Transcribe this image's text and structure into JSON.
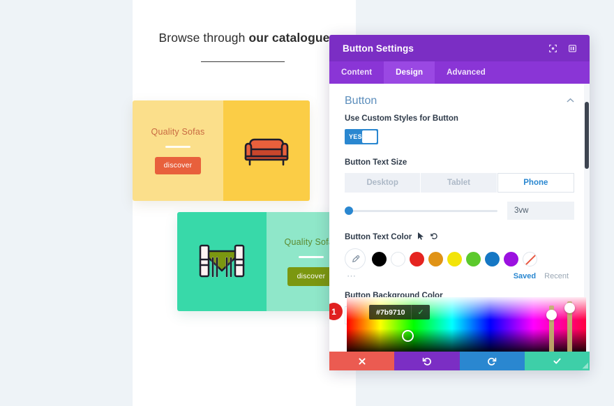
{
  "page": {
    "headline_plain": "Browse through ",
    "headline_bold": "our catalogue",
    "cards": [
      {
        "title": "Quality Sofas",
        "button_label": "discover",
        "icon": "sofa-icon",
        "panel_color": "#fbdf8b",
        "image_color": "#fbcd46",
        "button_color": "#e8603c"
      },
      {
        "title": "Quality Sofas",
        "button_label": "discover",
        "icon": "dining-table-icon",
        "panel_color": "#8fe7c9",
        "image_color": "#38d9a9",
        "button_color": "#7b9710"
      }
    ]
  },
  "modal": {
    "title": "Button Settings",
    "header_icons": [
      {
        "name": "focus-icon"
      },
      {
        "name": "layout-panel-icon"
      }
    ],
    "tabs": [
      {
        "label": "Content",
        "active": false
      },
      {
        "label": "Design",
        "active": true
      },
      {
        "label": "Advanced",
        "active": false
      }
    ],
    "section": {
      "title": "Button",
      "collapse_icon": "chevron-up-icon"
    },
    "custom_styles": {
      "label": "Use Custom Styles for Button",
      "toggle_value": "YES",
      "toggle_on": true
    },
    "text_size": {
      "label": "Button Text Size",
      "devices": [
        {
          "label": "Desktop",
          "active": false
        },
        {
          "label": "Tablet",
          "active": false
        },
        {
          "label": "Phone",
          "active": true
        }
      ],
      "slider_percent": 0,
      "value": "3vw"
    },
    "text_color": {
      "label": "Button Text Color",
      "cursor_icon": "mouse-pointer-icon",
      "reset_icon": "reset-arrow-icon",
      "eyedropper_icon": "eyedropper-icon",
      "more_icon": "ellipsis-icon",
      "swatches": [
        {
          "name": "swatch-black",
          "color": "#000000"
        },
        {
          "name": "swatch-white",
          "color": "#ffffff"
        },
        {
          "name": "swatch-red",
          "color": "#e52420"
        },
        {
          "name": "swatch-orange",
          "color": "#e09316"
        },
        {
          "name": "swatch-yellow",
          "color": "#f2e409"
        },
        {
          "name": "swatch-green",
          "color": "#5cc92c"
        },
        {
          "name": "swatch-blue",
          "color": "#1577c4"
        },
        {
          "name": "swatch-purple",
          "color": "#9b11e0"
        },
        {
          "name": "swatch-none",
          "color": "none"
        }
      ],
      "saved_label": "Saved",
      "recent_label": "Recent"
    },
    "background_color": {
      "label": "Button Background Color",
      "types": [
        {
          "name": "solid-fill-icon",
          "glyph": "⚈",
          "active": true
        },
        {
          "name": "gradient-icon",
          "glyph": "◨",
          "active": false
        },
        {
          "name": "image-icon",
          "glyph": "ὛB",
          "active": false
        }
      ]
    },
    "color_picker": {
      "hex_value": "#7b9710",
      "confirm_icon": "check-icon",
      "badge": "1"
    },
    "actions": [
      {
        "name": "cancel-button",
        "glyph": "✕",
        "color": "#eb5b51"
      },
      {
        "name": "undo-button",
        "glyph": "↺",
        "color": "#7b2ec4"
      },
      {
        "name": "redo-button",
        "glyph": "↻",
        "color": "#2a87d0"
      },
      {
        "name": "save-button",
        "glyph": "✓",
        "color": "#3ecfa8"
      }
    ]
  }
}
